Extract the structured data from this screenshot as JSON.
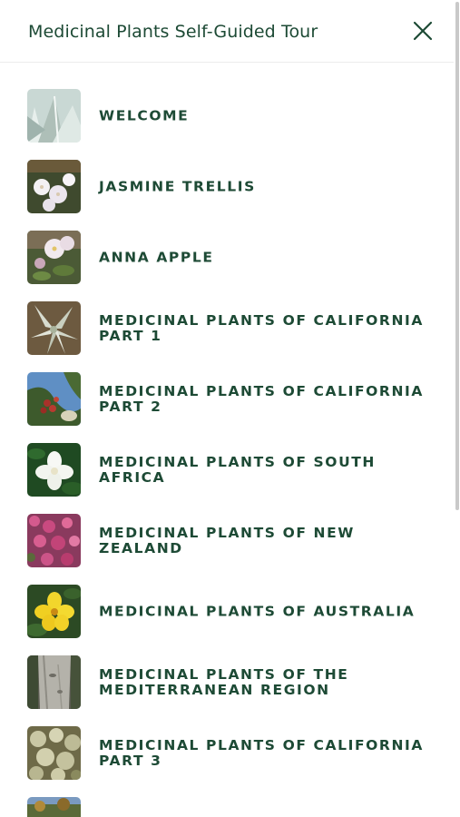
{
  "header": {
    "title": "Medicinal Plants Self-Guided Tour",
    "close_icon": "close-icon"
  },
  "tour_stops": [
    {
      "label": "WELCOME",
      "thumbnail": "succulent-leaves"
    },
    {
      "label": "JASMINE TRELLIS",
      "thumbnail": "white-jasmine"
    },
    {
      "label": "ANNA APPLE",
      "thumbnail": "apple-blossom"
    },
    {
      "label": "MEDICINAL PLANTS OF CALIFORNIA PART 1",
      "thumbnail": "sage-leaves"
    },
    {
      "label": "MEDICINAL PLANTS OF CALIFORNIA PART 2",
      "thumbnail": "red-berries-sky"
    },
    {
      "label": "MEDICINAL PLANTS OF SOUTH AFRICA",
      "thumbnail": "white-flower"
    },
    {
      "label": "MEDICINAL PLANTS OF NEW ZEALAND",
      "thumbnail": "pink-flowers"
    },
    {
      "label": "MEDICINAL PLANTS OF AUSTRALIA",
      "thumbnail": "yellow-flower"
    },
    {
      "label": "MEDICINAL PLANTS OF THE MEDITERRANEAN REGION",
      "thumbnail": "tree-trunk"
    },
    {
      "label": "MEDICINAL PLANTS OF CALIFORNIA PART 3",
      "thumbnail": "pale-shrub"
    },
    {
      "label": "",
      "thumbnail": "landscape-partial"
    }
  ],
  "colors": {
    "text": "#1d4a35",
    "divider": "#ececec",
    "scrollbar": "#c9c9c9"
  }
}
